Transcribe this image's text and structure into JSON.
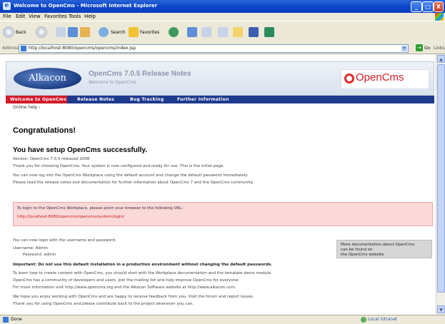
{
  "window": {
    "title": "Welcome to OpenCms - Microsoft Internet Explorer",
    "controls": {
      "minimize": "_",
      "maximize": "□",
      "close": "X"
    }
  },
  "menu": [
    "File",
    "Edit",
    "View",
    "Favorites",
    "Tools",
    "Help"
  ],
  "toolbar": {
    "back_label": "Back",
    "search_label": "Search",
    "favorites_label": "Favorites"
  },
  "address": {
    "label": "Address",
    "url": "http://localhost:8080/opencms/opencms/index.jsp",
    "go_label": "Go",
    "links_label": "Links"
  },
  "page": {
    "alkacon_logo": "Alkacon",
    "banner_title": "OpenCms 7.0.5 Release Notes",
    "banner_subtitle": "Welcome to OpenCms",
    "opencms_logo": "OpenCms",
    "nav": [
      "Welcome to OpenCms",
      "Release Notes",
      "Bug Tracking",
      "Further Information"
    ],
    "breadcrumb": "Online help ›",
    "h1": "Congratulations!",
    "h2": "You have setup OpenCms successfully.",
    "intro_lines": [
      "Version: OpenCms 7.0.5 released 2008",
      "Thank you for choosing OpenCms. Your system is now configured and ready for use. This is the initial page.",
      "You can now log into the OpenCms Workplace using the default account and change the default password immediately.",
      "Please read the release notes and documentation for further information about OpenCms 7 and the OpenCms community."
    ],
    "notice_line": "To login to the OpenCms Workplace, please point your browser to the following URL:",
    "notice_link": "http://localhost:8080/opencms/opencms/system/login/",
    "info_lines": [
      "You can now login with the username and password:",
      "Username: Admin",
      "Password: admin"
    ],
    "side_box_lines": [
      "More documentation about OpenCms",
      "can be found on",
      "the OpenCms website"
    ],
    "body_lines": [
      "Important: Do not use this default installation in a production environment without changing the default passwords.",
      "To learn how to create content with OpenCms, you should start with the Workplace documentation and the template demo module.",
      "OpenCms has a community of developers and users. Join the mailing list and help improve OpenCms for everyone.",
      "For more information visit http://www.opencms.org and the Alkacon Software website at http://www.alkacon.com.",
      "We hope you enjoy working with OpenCms and are happy to receive feedback from you. Visit the forum and report issues.",
      "Thank you for using OpenCms and please contribute back to the project whenever you can."
    ]
  },
  "status": {
    "text": "Done",
    "zone": "Local intranet"
  }
}
